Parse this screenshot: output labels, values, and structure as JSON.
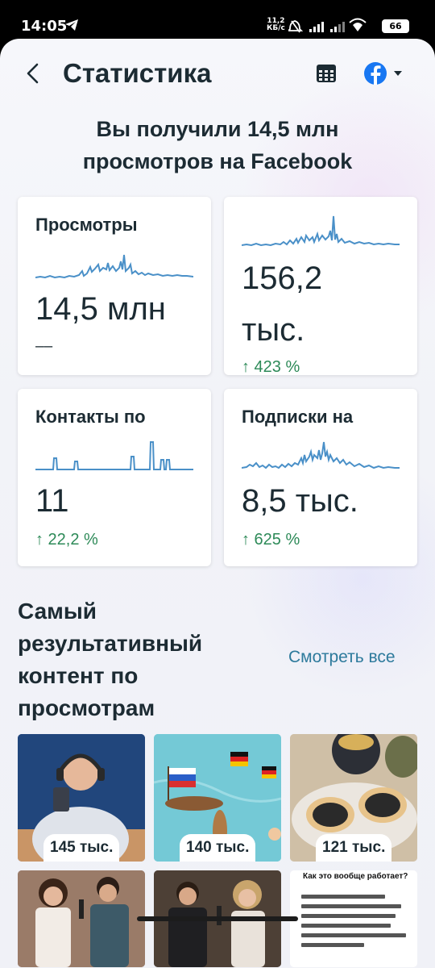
{
  "status_bar": {
    "time": "14:05",
    "speed_value": "11,2",
    "speed_unit": "КБ/с",
    "battery": "66"
  },
  "header": {
    "title": "Статистика"
  },
  "headline": "Вы получили 14,5 млн просмотров на Facebook",
  "cards": [
    {
      "title": "Просмотры",
      "value": "14,5 млн",
      "sub": "––",
      "delta": ""
    },
    {
      "title": "",
      "value_line1": "156,2",
      "value_line2": "тыс.",
      "delta": "↑ 423 %"
    },
    {
      "title": "Контакты по",
      "value": "11",
      "delta": "↑ 22,2 %"
    },
    {
      "title": "Подписки на",
      "value": "8,5 тыс.",
      "delta": "↑ 625 %"
    }
  ],
  "section": {
    "title": "Самый результативный контент по просмотрам",
    "see_all": "Смотреть все"
  },
  "thumbnails": [
    {
      "views": "145 тыс."
    },
    {
      "views": "140 тыс."
    },
    {
      "views": "121 тыс."
    }
  ],
  "document_thumb": {
    "title": "Как это вообще работает?"
  },
  "colors": {
    "accent_blue": "#1877f2",
    "spark_blue": "#4a90c8",
    "positive_green": "#2d8a58",
    "link": "#2d7a9c"
  }
}
